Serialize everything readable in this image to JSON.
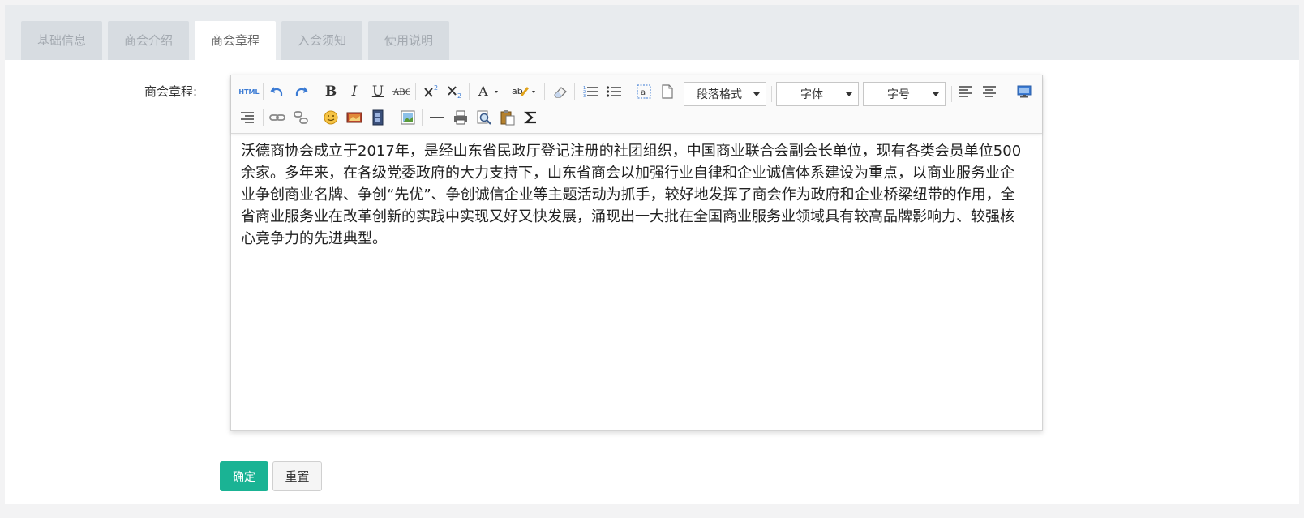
{
  "tabs": [
    {
      "label": "基础信息",
      "active": false
    },
    {
      "label": "商会介绍",
      "active": false
    },
    {
      "label": "商会章程",
      "active": true
    },
    {
      "label": "入会须知",
      "active": false
    },
    {
      "label": "使用说明",
      "active": false
    }
  ],
  "form": {
    "field_label": "商会章程:"
  },
  "toolbar": {
    "html_label": "HTML",
    "paragraph_format": "段落格式",
    "font_family": "字体",
    "font_size": "字号"
  },
  "editor": {
    "content": "沃德商协会成立于2017年，是经山东省民政厅登记注册的社团组织，中国商业联合会副会长单位，现有各类会员单位500余家。多年来，在各级党委政府的大力支持下，山东省商会以加强行业自律和企业诚信体系建设为重点，以商业服务业企业争创商业名牌、争创“先优”、争创诚信企业等主题活动为抓手，较好地发挥了商会作为政府和企业桥梁纽带的作用，全省商业服务业在改革创新的实践中实现又好又快发展，涌现出一大批在全国商业服务业领域具有较高品牌影响力、较强核心竞争力的先进典型。"
  },
  "buttons": {
    "confirm": "确定",
    "reset": "重置"
  },
  "colors": {
    "primary": "#1ab394",
    "tab_bg": "#d7dce1",
    "tabbar_bg": "#e8ebee",
    "icon_blue": "#3b7bd4"
  }
}
